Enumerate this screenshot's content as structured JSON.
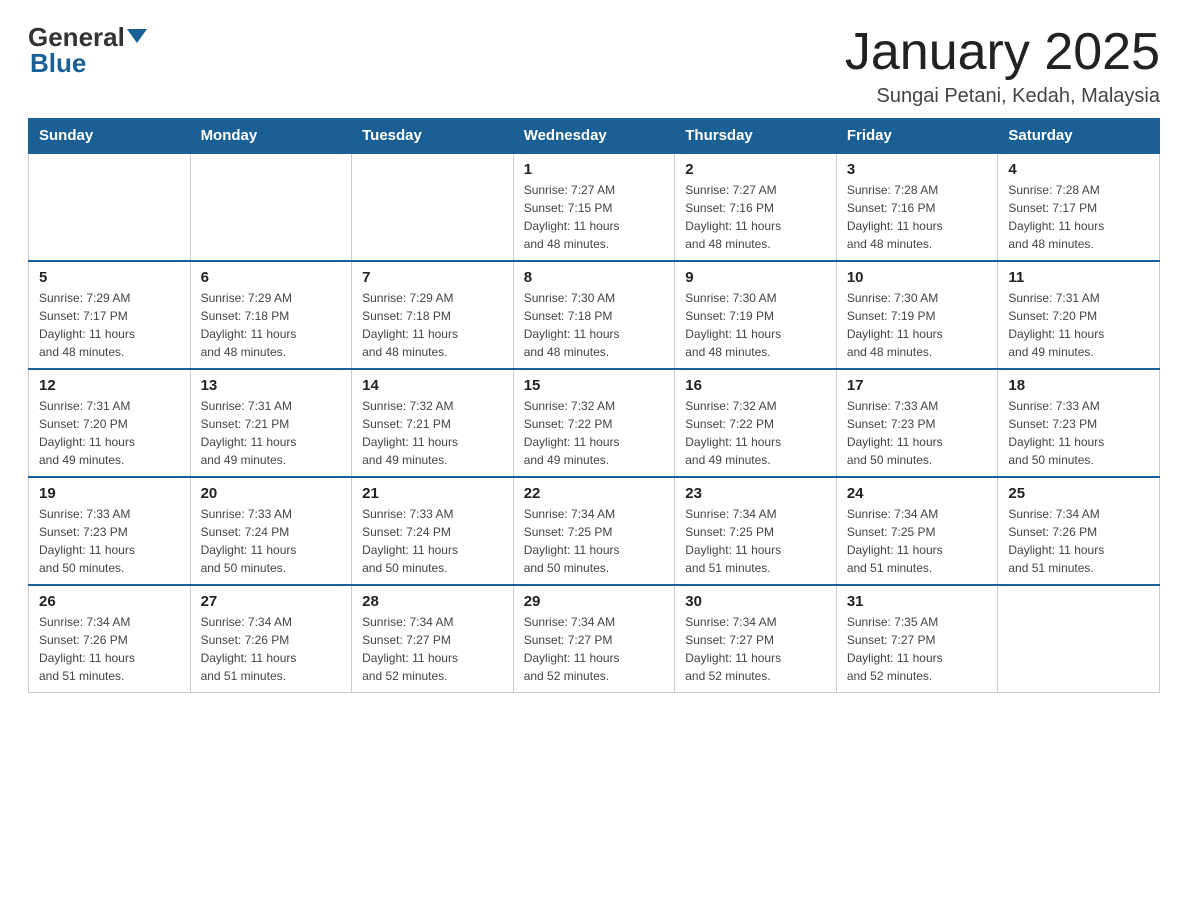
{
  "header": {
    "logo_general": "General",
    "logo_blue": "Blue",
    "title": "January 2025",
    "subtitle": "Sungai Petani, Kedah, Malaysia"
  },
  "days_of_week": [
    "Sunday",
    "Monday",
    "Tuesday",
    "Wednesday",
    "Thursday",
    "Friday",
    "Saturday"
  ],
  "weeks": [
    [
      {
        "day": "",
        "info": ""
      },
      {
        "day": "",
        "info": ""
      },
      {
        "day": "",
        "info": ""
      },
      {
        "day": "1",
        "info": "Sunrise: 7:27 AM\nSunset: 7:15 PM\nDaylight: 11 hours\nand 48 minutes."
      },
      {
        "day": "2",
        "info": "Sunrise: 7:27 AM\nSunset: 7:16 PM\nDaylight: 11 hours\nand 48 minutes."
      },
      {
        "day": "3",
        "info": "Sunrise: 7:28 AM\nSunset: 7:16 PM\nDaylight: 11 hours\nand 48 minutes."
      },
      {
        "day": "4",
        "info": "Sunrise: 7:28 AM\nSunset: 7:17 PM\nDaylight: 11 hours\nand 48 minutes."
      }
    ],
    [
      {
        "day": "5",
        "info": "Sunrise: 7:29 AM\nSunset: 7:17 PM\nDaylight: 11 hours\nand 48 minutes."
      },
      {
        "day": "6",
        "info": "Sunrise: 7:29 AM\nSunset: 7:18 PM\nDaylight: 11 hours\nand 48 minutes."
      },
      {
        "day": "7",
        "info": "Sunrise: 7:29 AM\nSunset: 7:18 PM\nDaylight: 11 hours\nand 48 minutes."
      },
      {
        "day": "8",
        "info": "Sunrise: 7:30 AM\nSunset: 7:18 PM\nDaylight: 11 hours\nand 48 minutes."
      },
      {
        "day": "9",
        "info": "Sunrise: 7:30 AM\nSunset: 7:19 PM\nDaylight: 11 hours\nand 48 minutes."
      },
      {
        "day": "10",
        "info": "Sunrise: 7:30 AM\nSunset: 7:19 PM\nDaylight: 11 hours\nand 48 minutes."
      },
      {
        "day": "11",
        "info": "Sunrise: 7:31 AM\nSunset: 7:20 PM\nDaylight: 11 hours\nand 49 minutes."
      }
    ],
    [
      {
        "day": "12",
        "info": "Sunrise: 7:31 AM\nSunset: 7:20 PM\nDaylight: 11 hours\nand 49 minutes."
      },
      {
        "day": "13",
        "info": "Sunrise: 7:31 AM\nSunset: 7:21 PM\nDaylight: 11 hours\nand 49 minutes."
      },
      {
        "day": "14",
        "info": "Sunrise: 7:32 AM\nSunset: 7:21 PM\nDaylight: 11 hours\nand 49 minutes."
      },
      {
        "day": "15",
        "info": "Sunrise: 7:32 AM\nSunset: 7:22 PM\nDaylight: 11 hours\nand 49 minutes."
      },
      {
        "day": "16",
        "info": "Sunrise: 7:32 AM\nSunset: 7:22 PM\nDaylight: 11 hours\nand 49 minutes."
      },
      {
        "day": "17",
        "info": "Sunrise: 7:33 AM\nSunset: 7:23 PM\nDaylight: 11 hours\nand 50 minutes."
      },
      {
        "day": "18",
        "info": "Sunrise: 7:33 AM\nSunset: 7:23 PM\nDaylight: 11 hours\nand 50 minutes."
      }
    ],
    [
      {
        "day": "19",
        "info": "Sunrise: 7:33 AM\nSunset: 7:23 PM\nDaylight: 11 hours\nand 50 minutes."
      },
      {
        "day": "20",
        "info": "Sunrise: 7:33 AM\nSunset: 7:24 PM\nDaylight: 11 hours\nand 50 minutes."
      },
      {
        "day": "21",
        "info": "Sunrise: 7:33 AM\nSunset: 7:24 PM\nDaylight: 11 hours\nand 50 minutes."
      },
      {
        "day": "22",
        "info": "Sunrise: 7:34 AM\nSunset: 7:25 PM\nDaylight: 11 hours\nand 50 minutes."
      },
      {
        "day": "23",
        "info": "Sunrise: 7:34 AM\nSunset: 7:25 PM\nDaylight: 11 hours\nand 51 minutes."
      },
      {
        "day": "24",
        "info": "Sunrise: 7:34 AM\nSunset: 7:25 PM\nDaylight: 11 hours\nand 51 minutes."
      },
      {
        "day": "25",
        "info": "Sunrise: 7:34 AM\nSunset: 7:26 PM\nDaylight: 11 hours\nand 51 minutes."
      }
    ],
    [
      {
        "day": "26",
        "info": "Sunrise: 7:34 AM\nSunset: 7:26 PM\nDaylight: 11 hours\nand 51 minutes."
      },
      {
        "day": "27",
        "info": "Sunrise: 7:34 AM\nSunset: 7:26 PM\nDaylight: 11 hours\nand 51 minutes."
      },
      {
        "day": "28",
        "info": "Sunrise: 7:34 AM\nSunset: 7:27 PM\nDaylight: 11 hours\nand 52 minutes."
      },
      {
        "day": "29",
        "info": "Sunrise: 7:34 AM\nSunset: 7:27 PM\nDaylight: 11 hours\nand 52 minutes."
      },
      {
        "day": "30",
        "info": "Sunrise: 7:34 AM\nSunset: 7:27 PM\nDaylight: 11 hours\nand 52 minutes."
      },
      {
        "day": "31",
        "info": "Sunrise: 7:35 AM\nSunset: 7:27 PM\nDaylight: 11 hours\nand 52 minutes."
      },
      {
        "day": "",
        "info": ""
      }
    ]
  ],
  "colors": {
    "header_bg": "#1a6094",
    "header_text": "#ffffff",
    "border_top": "#1a6094"
  }
}
